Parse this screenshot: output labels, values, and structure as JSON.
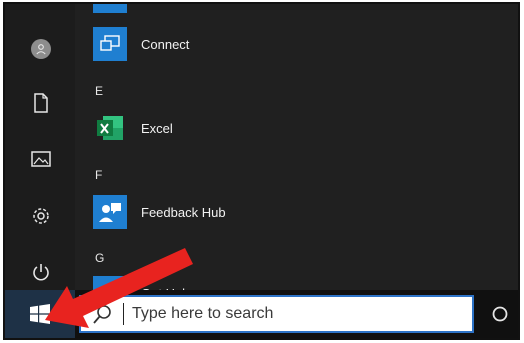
{
  "start_menu": {
    "rail": {
      "items": [
        {
          "icon": "user-icon"
        },
        {
          "icon": "document-icon"
        },
        {
          "icon": "pictures-icon"
        },
        {
          "icon": "settings-icon"
        },
        {
          "icon": "power-icon"
        }
      ]
    },
    "apps": [
      {
        "label": "Connect",
        "icon": "connect-icon",
        "color": "#1f7fd1"
      },
      {
        "header": "E"
      },
      {
        "label": "Excel",
        "icon": "excel-icon",
        "color": "#1e7145"
      },
      {
        "header": "F"
      },
      {
        "label": "Feedback Hub",
        "icon": "feedback-hub-icon",
        "color": "#1f7fd1"
      },
      {
        "header": "G"
      },
      {
        "label": "Get Help",
        "icon": "get-help-icon",
        "color": "#1f7fd1"
      }
    ]
  },
  "taskbar": {
    "start_icon": "windows-logo-icon",
    "search": {
      "placeholder": "Type here to search",
      "icon": "search-icon"
    },
    "cortana_icon": "cortana-icon",
    "accent": "#2d73c7"
  },
  "annotation": {
    "arrow_color": "#e8231f"
  }
}
